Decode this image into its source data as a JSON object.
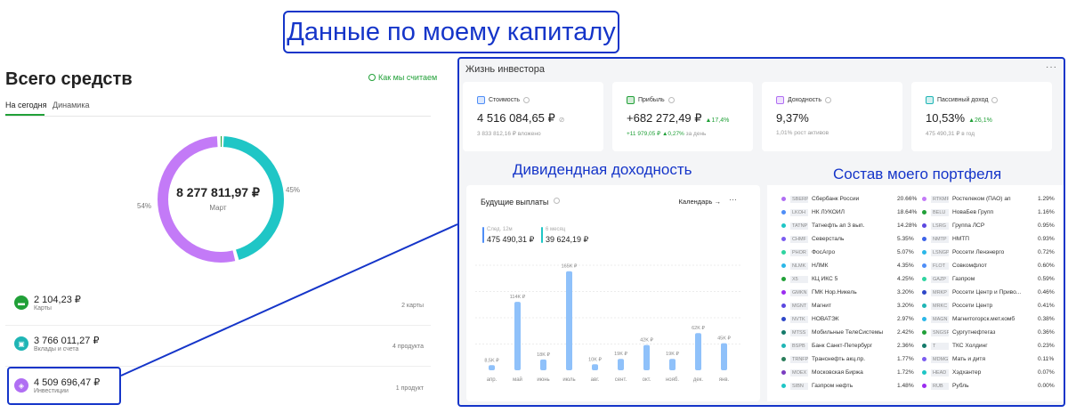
{
  "banner": "Данные по моему капиталу",
  "left": {
    "title": "Всего средств",
    "how_link": "Как мы считаем",
    "tabs": [
      "На сегодня",
      "Динамика"
    ],
    "donut": {
      "total": "8 277 811,97 ₽",
      "month": "Март",
      "left_pct": "54%",
      "right_pct": "45%",
      "share_invest": 0.545,
      "share_deposits": 0.455,
      "color_invest": "#c37af7",
      "color_deposits": "#1fc6c6",
      "color_cards": "#21a038"
    },
    "rows": [
      {
        "amount": "2 104,23 ₽",
        "label": "Карты",
        "count": "2 карты",
        "color": "#21a038",
        "icon": "card-icon"
      },
      {
        "amount": "3 766 011,27 ₽",
        "label": "Вклады и счета",
        "count": "4 продукта",
        "color": "#1fb5b5",
        "icon": "safe-icon"
      },
      {
        "amount": "4 509 696,47 ₽",
        "label": "Инвестиции",
        "count": "1 продукт",
        "color": "#b06ef3",
        "icon": "portfolio-icon"
      }
    ]
  },
  "right": {
    "title": "Жизнь инвестора",
    "menu": "···",
    "stats": [
      {
        "title": "Стоимость",
        "value": "4 516 084,65 ₽",
        "delta": "",
        "sub_prefix": "3 833 812,16 ₽ вложено",
        "sub_delta": "",
        "sub_suffix": "",
        "color": "#4f8ef7",
        "icon": "wallet-icon"
      },
      {
        "title": "Прибыль",
        "value": "+682 272,49 ₽",
        "delta": "▲17,4%",
        "sub_prefix": "+11 979,05 ₽",
        "sub_delta": " ▲0,27%",
        "sub_suffix": " за день",
        "color": "#21a038",
        "icon": "chart-up-icon"
      },
      {
        "title": "Доходность",
        "value": "9,37%",
        "delta": "",
        "sub_prefix": "1,01% рост активов",
        "sub_delta": "",
        "sub_suffix": "",
        "color": "#b06ef3",
        "icon": "percent-icon"
      },
      {
        "title": "Пассивный доход",
        "value": "10,53%",
        "delta": "▲26,1%",
        "sub_prefix": "475 490,31 ₽ в год",
        "sub_delta": "",
        "sub_suffix": "",
        "color": "#1fb5b5",
        "icon": "coins-icon"
      }
    ],
    "div_label": "Дивидендная доходность",
    "comp_label": "Состав моего портфеля",
    "payouts": {
      "title": "Будущие выплаты",
      "calendar": "Календарь →",
      "menu": "···",
      "next12_label": "След. 12м",
      "next12_value": "475 490,31 ₽",
      "six_label": "6 месяц",
      "six_value": "39 624,19 ₽",
      "color_next12": "#4f8ef7",
      "color_six": "#1fc6c6"
    },
    "composition": [
      {
        "ticker": "SBERP",
        "name": "Сбербанк России",
        "pct": "20.66%",
        "color": "#b06ef3"
      },
      {
        "ticker": "LKOH",
        "name": "НК ЛУКОЙЛ",
        "pct": "18.64%",
        "color": "#4f8ef7"
      },
      {
        "ticker": "TATNP",
        "name": "Татнефть ап 3 вып.",
        "pct": "14.28%",
        "color": "#1fc6c6"
      },
      {
        "ticker": "CHMF",
        "name": "Северсталь",
        "pct": "5.35%",
        "color": "#7b5cf0"
      },
      {
        "ticker": "PHOR",
        "name": "ФосАгро",
        "pct": "5.07%",
        "color": "#2fd4a0"
      },
      {
        "ticker": "NLMK",
        "name": "НЛМК",
        "pct": "4.35%",
        "color": "#2bb7e8"
      },
      {
        "ticker": "X5",
        "name": "КЦ ИКС 5",
        "pct": "4.25%",
        "color": "#21a038"
      },
      {
        "ticker": "GMKN",
        "name": "ГМК Нор.Никель",
        "pct": "3.20%",
        "color": "#9b2cf0"
      },
      {
        "ticker": "MGNT",
        "name": "Магнит",
        "pct": "3.20%",
        "color": "#5b48e0"
      },
      {
        "ticker": "NVTK",
        "name": "НОВАТЭК",
        "pct": "2.97%",
        "color": "#2e47c8"
      },
      {
        "ticker": "MTSS",
        "name": "Мобильные ТелеСистемы",
        "pct": "2.42%",
        "color": "#147a6a"
      },
      {
        "ticker": "BSPB",
        "name": "Банк Санкт-Петербург",
        "pct": "2.36%",
        "color": "#1fb5b5"
      },
      {
        "ticker": "TRNFP",
        "name": "Транснефть акц.пр.",
        "pct": "1.77%",
        "color": "#2a7d5a"
      },
      {
        "ticker": "MOEX",
        "name": "Московская Биржа",
        "pct": "1.72%",
        "color": "#7a3cc0"
      },
      {
        "ticker": "SIBN",
        "name": "Газпром нефть",
        "pct": "1.48%",
        "color": "#1fc6c6"
      },
      {
        "ticker": "RTKMP",
        "name": "Ростелеком (ПАО) ап",
        "pct": "1.29%",
        "color": "#c37af7"
      },
      {
        "ticker": "BELU",
        "name": "НоваБев Групп",
        "pct": "1.16%",
        "color": "#21a038"
      },
      {
        "ticker": "LSRG",
        "name": "Группа ЛСР",
        "pct": "0.95%",
        "color": "#5b48e0"
      },
      {
        "ticker": "NMTP",
        "name": "НМТП",
        "pct": "0.93%",
        "color": "#3c63e8"
      },
      {
        "ticker": "LSNGP",
        "name": "Россети Ленэнерго",
        "pct": "0.72%",
        "color": "#2bb7e8"
      },
      {
        "ticker": "FLOT",
        "name": "Совкомфлот",
        "pct": "0.60%",
        "color": "#4f8ef7"
      },
      {
        "ticker": "GAZP",
        "name": "Газпром",
        "pct": "0.59%",
        "color": "#2fd4a0"
      },
      {
        "ticker": "MRKP",
        "name": "Россети Центр и Приво...",
        "pct": "0.46%",
        "color": "#2e47c8"
      },
      {
        "ticker": "MRKC",
        "name": "Россети Центр",
        "pct": "0.41%",
        "color": "#1fb5b5"
      },
      {
        "ticker": "MAGN",
        "name": "Магнитогорск.мет.комб",
        "pct": "0.38%",
        "color": "#2bb7e8"
      },
      {
        "ticker": "SNGSP",
        "name": "Сургутнефтегаз",
        "pct": "0.36%",
        "color": "#21a038"
      },
      {
        "ticker": "T",
        "name": "ТКС Холдинг",
        "pct": "0.23%",
        "color": "#147a6a"
      },
      {
        "ticker": "MDMG",
        "name": "Мать и дитя",
        "pct": "0.11%",
        "color": "#7b5cf0"
      },
      {
        "ticker": "HEAD",
        "name": "Хэдхантер",
        "pct": "0.07%",
        "color": "#1fc6c6"
      },
      {
        "ticker": "RUB",
        "name": "Рубль",
        "pct": "0.00%",
        "color": "#9b2cf0"
      }
    ]
  },
  "chart_data": {
    "type": "bar",
    "title": "Будущие выплаты",
    "categories": [
      "апр.",
      "май",
      "июнь",
      "июль",
      "авг.",
      "сент.",
      "окт.",
      "нояб.",
      "дек.",
      "янв."
    ],
    "values": [
      8.5,
      114,
      18,
      165,
      10,
      19,
      42,
      19,
      62,
      45
    ],
    "data_labels": [
      "8,5K ₽",
      "114K ₽",
      "18K ₽",
      "165K ₽",
      "10K ₽",
      "19K ₽",
      "42K ₽",
      "19K ₽",
      "62K ₽",
      "45K ₽"
    ],
    "ylim": [
      0,
      175
    ],
    "bar_color": "#8fc1fa",
    "grid": true
  }
}
